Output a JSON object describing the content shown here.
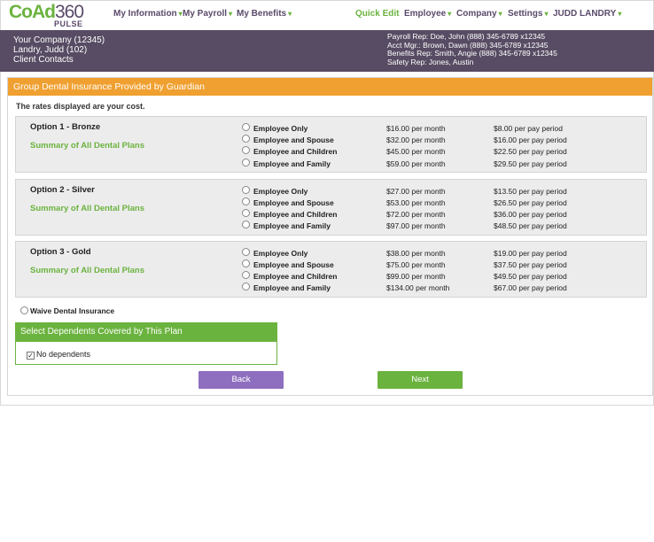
{
  "logo": {
    "brand_a": "CoAd",
    "brand_b": "360",
    "sub": "PULSE"
  },
  "nav": {
    "my_information": "My Information",
    "my_payroll": "My Payroll",
    "my_benefits": "My Benefits",
    "quick_edit": "Quick Edit",
    "employee": "Employee",
    "company": "Company",
    "settings": "Settings",
    "user": "JUDD LANDRY",
    "caret": "▾"
  },
  "banner": {
    "company": "Your Company (12345)",
    "employee": "Landry, Judd (102)",
    "client_contacts": "Client Contacts",
    "payroll_rep": "Payroll Rep: Doe, John (888) 345-6789 x12345",
    "acct_mgr": "Acct Mgr.: Brown, Dawn (888) 345-6789 x12345",
    "benefits_rep": "Benefits Rep: Smith, Angie (888) 345-6789 x12345",
    "safety_rep": "Safety Rep: Jones, Austin"
  },
  "panel": {
    "title": "Group Dental Insurance Provided by Guardian",
    "rates_note": "The rates displayed are your cost."
  },
  "options": [
    {
      "title": "Option 1 - Bronze",
      "summary": "Summary of All Dental Plans",
      "tiers": [
        {
          "name": "Employee Only",
          "month": "$16.00 per month",
          "period": "$8.00 per pay period"
        },
        {
          "name": "Employee and Spouse",
          "month": "$32.00 per month",
          "period": "$16.00 per pay period"
        },
        {
          "name": "Employee and Children",
          "month": "$45.00 per month",
          "period": "$22.50 per pay period"
        },
        {
          "name": "Employee and Family",
          "month": "$59.00 per month",
          "period": "$29.50 per pay period"
        }
      ]
    },
    {
      "title": "Option 2 - Silver",
      "summary": "Summary of All Dental Plans",
      "tiers": [
        {
          "name": "Employee Only",
          "month": "$27.00 per month",
          "period": "$13.50 per pay period"
        },
        {
          "name": "Employee and Spouse",
          "month": "$53.00 per month",
          "period": "$26.50 per pay period"
        },
        {
          "name": "Employee and Children",
          "month": "$72.00 per month",
          "period": "$36.00 per pay period"
        },
        {
          "name": "Employee and Family",
          "month": "$97.00 per month",
          "period": "$48.50 per pay period"
        }
      ]
    },
    {
      "title": "Option 3 - Gold",
      "summary": "Summary of All Dental Plans",
      "tiers": [
        {
          "name": "Employee Only",
          "month": "$38.00 per month",
          "period": "$19.00 per pay period"
        },
        {
          "name": "Employee and Spouse",
          "month": "$75.00 per month",
          "period": "$37.50 per pay period"
        },
        {
          "name": "Employee and Children",
          "month": "$99.00 per month",
          "period": "$49.50 per pay period"
        },
        {
          "name": "Employee and Family",
          "month": "$134.00 per month",
          "period": "$67.00 per pay period"
        }
      ]
    }
  ],
  "waive": {
    "label": "Waive Dental Insurance"
  },
  "dependents": {
    "title": "Select Dependents Covered by This Plan",
    "no_dependents_label": "No dependents",
    "no_dependents_checked": true,
    "check_glyph": "✓"
  },
  "buttons": {
    "back": "Back",
    "next": "Next"
  },
  "colors": {
    "brand_green": "#6bb33f",
    "brand_purple": "#574c63",
    "header_orange": "#f0a030",
    "back_button": "#8e6fbf"
  }
}
